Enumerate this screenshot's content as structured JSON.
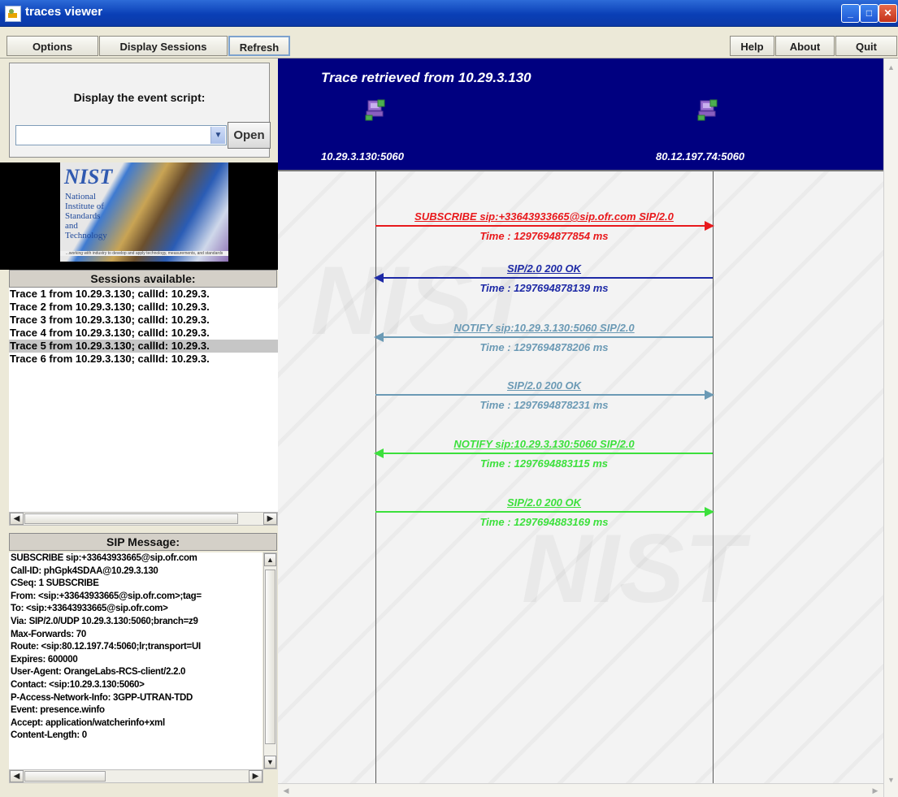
{
  "window": {
    "title": "traces viewer",
    "minimize": "_",
    "maximize": "□",
    "close": "✕"
  },
  "menu": {
    "options": "Options",
    "display_sessions": "Display Sessions",
    "refresh": "Refresh",
    "help": "Help",
    "about": "About",
    "quit": "Quit"
  },
  "script_panel": {
    "label": "Display the event script:",
    "open_button": "Open",
    "selected": ""
  },
  "logo": {
    "line1": "NIST",
    "line2": "National Institute of Standards and Technology",
    "tagline": "...working with industry to develop and apply technology, measurements, and standards"
  },
  "sessions": {
    "header": "Sessions available:",
    "items": [
      "Trace 1 from 10.29.3.130; callId: 10.29.3.",
      "Trace 2 from 10.29.3.130; callId: 10.29.3.",
      "Trace 3 from 10.29.3.130; callId: 10.29.3.",
      "Trace 4 from 10.29.3.130; callId: 10.29.3.",
      "Trace 5 from 10.29.3.130; callId: 10.29.3.",
      "Trace 6 from 10.29.3.130; callId: 10.29.3."
    ],
    "selected_index": 4
  },
  "sip_message": {
    "header": "SIP Message:",
    "lines": [
      "SUBSCRIBE sip:+33643933665@sip.ofr.com",
      "Call-ID: phGpk4SDAA@10.29.3.130",
      "CSeq: 1 SUBSCRIBE",
      "From: <sip:+33643933665@sip.ofr.com>;tag=",
      "To: <sip:+33643933665@sip.ofr.com>",
      "Via: SIP/2.0/UDP 10.29.3.130:5060;branch=z9",
      "Max-Forwards: 70",
      "Route: <sip:80.12.197.74:5060;lr;transport=UI",
      "Expires: 600000",
      "User-Agent: OrangeLabs-RCS-client/2.2.0",
      "Contact: <sip:10.29.3.130:5060>",
      "P-Access-Network-Info: 3GPP-UTRAN-TDD",
      "Event: presence.winfo",
      "Accept: application/watcherinfo+xml",
      "Content-Length: 0"
    ]
  },
  "trace": {
    "title": "Trace retrieved from 10.29.3.130",
    "left_host": "10.29.3.130:5060",
    "right_host": "80.12.197.74:5060",
    "messages": [
      {
        "label": "SUBSCRIBE sip:+33643933665@sip.ofr.com SIP/2.0",
        "time": "Time : 1297694877854 ms",
        "direction": "right",
        "color": "#e8191c"
      },
      {
        "label": "SIP/2.0 200 OK",
        "time": "Time : 1297694878139 ms",
        "direction": "left",
        "color": "#1e2aa6"
      },
      {
        "label": "NOTIFY sip:10.29.3.130:5060 SIP/2.0",
        "time": "Time : 1297694878206 ms",
        "direction": "left",
        "color": "#6b9ab5"
      },
      {
        "label": "SIP/2.0 200 OK",
        "time": "Time : 1297694878231 ms",
        "direction": "right",
        "color": "#6b9ab5"
      },
      {
        "label": "NOTIFY sip:10.29.3.130:5060 SIP/2.0",
        "time": "Time : 1297694883115 ms",
        "direction": "left",
        "color": "#3ce03c"
      },
      {
        "label": "SIP/2.0 200 OK",
        "time": "Time : 1297694883169 ms",
        "direction": "right",
        "color": "#3ce03c"
      }
    ]
  }
}
